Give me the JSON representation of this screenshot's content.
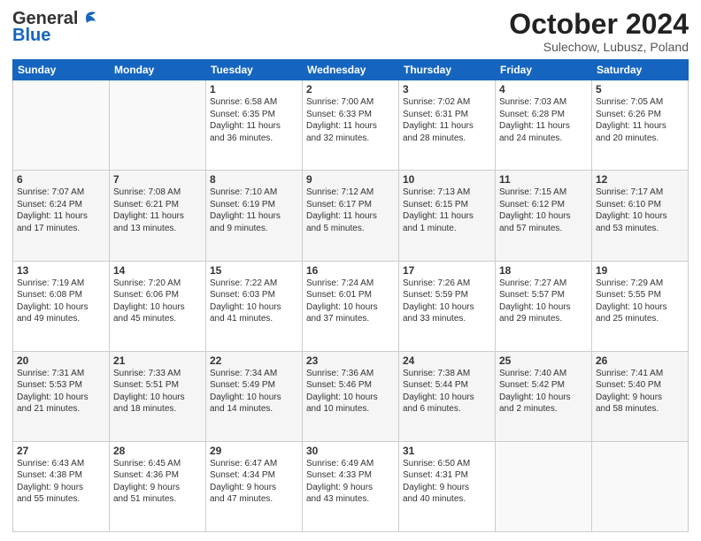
{
  "logo": {
    "line1": "General",
    "line2": "Blue"
  },
  "header": {
    "month": "October 2024",
    "location": "Sulechow, Lubusz, Poland"
  },
  "days_of_week": [
    "Sunday",
    "Monday",
    "Tuesday",
    "Wednesday",
    "Thursday",
    "Friday",
    "Saturday"
  ],
  "rows": [
    [
      {
        "day": "",
        "info": ""
      },
      {
        "day": "",
        "info": ""
      },
      {
        "day": "1",
        "info": "Sunrise: 6:58 AM\nSunset: 6:35 PM\nDaylight: 11 hours\nand 36 minutes."
      },
      {
        "day": "2",
        "info": "Sunrise: 7:00 AM\nSunset: 6:33 PM\nDaylight: 11 hours\nand 32 minutes."
      },
      {
        "day": "3",
        "info": "Sunrise: 7:02 AM\nSunset: 6:31 PM\nDaylight: 11 hours\nand 28 minutes."
      },
      {
        "day": "4",
        "info": "Sunrise: 7:03 AM\nSunset: 6:28 PM\nDaylight: 11 hours\nand 24 minutes."
      },
      {
        "day": "5",
        "info": "Sunrise: 7:05 AM\nSunset: 6:26 PM\nDaylight: 11 hours\nand 20 minutes."
      }
    ],
    [
      {
        "day": "6",
        "info": "Sunrise: 7:07 AM\nSunset: 6:24 PM\nDaylight: 11 hours\nand 17 minutes."
      },
      {
        "day": "7",
        "info": "Sunrise: 7:08 AM\nSunset: 6:21 PM\nDaylight: 11 hours\nand 13 minutes."
      },
      {
        "day": "8",
        "info": "Sunrise: 7:10 AM\nSunset: 6:19 PM\nDaylight: 11 hours\nand 9 minutes."
      },
      {
        "day": "9",
        "info": "Sunrise: 7:12 AM\nSunset: 6:17 PM\nDaylight: 11 hours\nand 5 minutes."
      },
      {
        "day": "10",
        "info": "Sunrise: 7:13 AM\nSunset: 6:15 PM\nDaylight: 11 hours\nand 1 minute."
      },
      {
        "day": "11",
        "info": "Sunrise: 7:15 AM\nSunset: 6:12 PM\nDaylight: 10 hours\nand 57 minutes."
      },
      {
        "day": "12",
        "info": "Sunrise: 7:17 AM\nSunset: 6:10 PM\nDaylight: 10 hours\nand 53 minutes."
      }
    ],
    [
      {
        "day": "13",
        "info": "Sunrise: 7:19 AM\nSunset: 6:08 PM\nDaylight: 10 hours\nand 49 minutes."
      },
      {
        "day": "14",
        "info": "Sunrise: 7:20 AM\nSunset: 6:06 PM\nDaylight: 10 hours\nand 45 minutes."
      },
      {
        "day": "15",
        "info": "Sunrise: 7:22 AM\nSunset: 6:03 PM\nDaylight: 10 hours\nand 41 minutes."
      },
      {
        "day": "16",
        "info": "Sunrise: 7:24 AM\nSunset: 6:01 PM\nDaylight: 10 hours\nand 37 minutes."
      },
      {
        "day": "17",
        "info": "Sunrise: 7:26 AM\nSunset: 5:59 PM\nDaylight: 10 hours\nand 33 minutes."
      },
      {
        "day": "18",
        "info": "Sunrise: 7:27 AM\nSunset: 5:57 PM\nDaylight: 10 hours\nand 29 minutes."
      },
      {
        "day": "19",
        "info": "Sunrise: 7:29 AM\nSunset: 5:55 PM\nDaylight: 10 hours\nand 25 minutes."
      }
    ],
    [
      {
        "day": "20",
        "info": "Sunrise: 7:31 AM\nSunset: 5:53 PM\nDaylight: 10 hours\nand 21 minutes."
      },
      {
        "day": "21",
        "info": "Sunrise: 7:33 AM\nSunset: 5:51 PM\nDaylight: 10 hours\nand 18 minutes."
      },
      {
        "day": "22",
        "info": "Sunrise: 7:34 AM\nSunset: 5:49 PM\nDaylight: 10 hours\nand 14 minutes."
      },
      {
        "day": "23",
        "info": "Sunrise: 7:36 AM\nSunset: 5:46 PM\nDaylight: 10 hours\nand 10 minutes."
      },
      {
        "day": "24",
        "info": "Sunrise: 7:38 AM\nSunset: 5:44 PM\nDaylight: 10 hours\nand 6 minutes."
      },
      {
        "day": "25",
        "info": "Sunrise: 7:40 AM\nSunset: 5:42 PM\nDaylight: 10 hours\nand 2 minutes."
      },
      {
        "day": "26",
        "info": "Sunrise: 7:41 AM\nSunset: 5:40 PM\nDaylight: 9 hours\nand 58 minutes."
      }
    ],
    [
      {
        "day": "27",
        "info": "Sunrise: 6:43 AM\nSunset: 4:38 PM\nDaylight: 9 hours\nand 55 minutes."
      },
      {
        "day": "28",
        "info": "Sunrise: 6:45 AM\nSunset: 4:36 PM\nDaylight: 9 hours\nand 51 minutes."
      },
      {
        "day": "29",
        "info": "Sunrise: 6:47 AM\nSunset: 4:34 PM\nDaylight: 9 hours\nand 47 minutes."
      },
      {
        "day": "30",
        "info": "Sunrise: 6:49 AM\nSunset: 4:33 PM\nDaylight: 9 hours\nand 43 minutes."
      },
      {
        "day": "31",
        "info": "Sunrise: 6:50 AM\nSunset: 4:31 PM\nDaylight: 9 hours\nand 40 minutes."
      },
      {
        "day": "",
        "info": ""
      },
      {
        "day": "",
        "info": ""
      }
    ]
  ]
}
